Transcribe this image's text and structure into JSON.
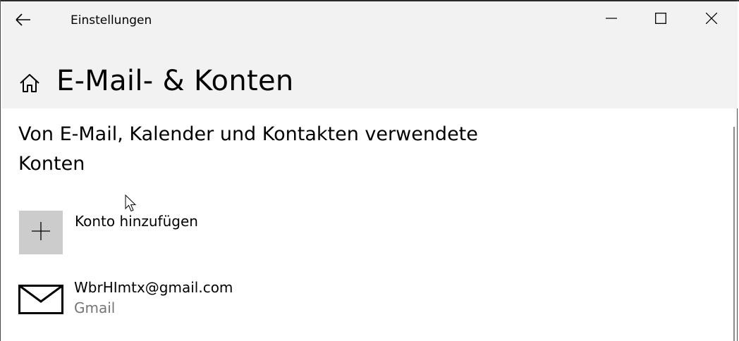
{
  "window": {
    "title": "Einstellungen",
    "icons": {
      "back": "back-arrow-icon",
      "minimize": "minimize-icon",
      "maximize": "maximize-icon",
      "close": "close-icon"
    }
  },
  "header": {
    "title": "E-Mail- & Konten",
    "home_icon": "home-icon"
  },
  "section": {
    "title": "Von E-Mail, Kalender und Kontakten verwendete Konten"
  },
  "add_account": {
    "label": "Konto hinzufügen",
    "icon": "plus-icon"
  },
  "accounts": [
    {
      "email": "WbrHImtx@gmail.com",
      "provider": "Gmail",
      "icon": "mail-envelope-icon"
    }
  ],
  "colors": {
    "chrome_background": "#f2f2f2",
    "tile_background": "#cccccc",
    "secondary_text": "#767676"
  }
}
